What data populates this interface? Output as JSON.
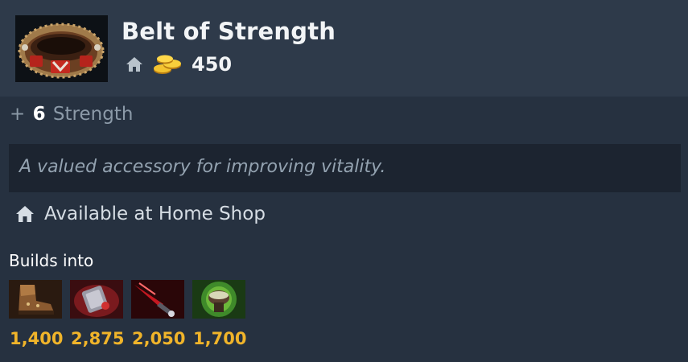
{
  "item": {
    "name": "Belt of Strength",
    "icon": "belt-of-strength-icon",
    "cost": "450",
    "cost_icons": [
      "home-icon",
      "gold-coins-icon"
    ]
  },
  "stat": {
    "prefix": "+",
    "value": "6",
    "attribute": "Strength"
  },
  "lore": "A valued accessory for improving vitality.",
  "availability": {
    "icon": "home-icon",
    "text": "Available at Home Shop"
  },
  "builds_into": {
    "label": "Builds into",
    "items": [
      {
        "icon": "power-treads-icon",
        "price": "1,400"
      },
      {
        "icon": "sange-icon",
        "price": "2,875"
      },
      {
        "icon": "bloodthorn-blade-icon",
        "price": "2,050"
      },
      {
        "icon": "pavise-icon",
        "price": "1,700"
      }
    ]
  },
  "colors": {
    "background": "#263140",
    "header": "#2e3a4a",
    "lore_box": "#1c2430",
    "gold_price": "#f0b42a"
  }
}
